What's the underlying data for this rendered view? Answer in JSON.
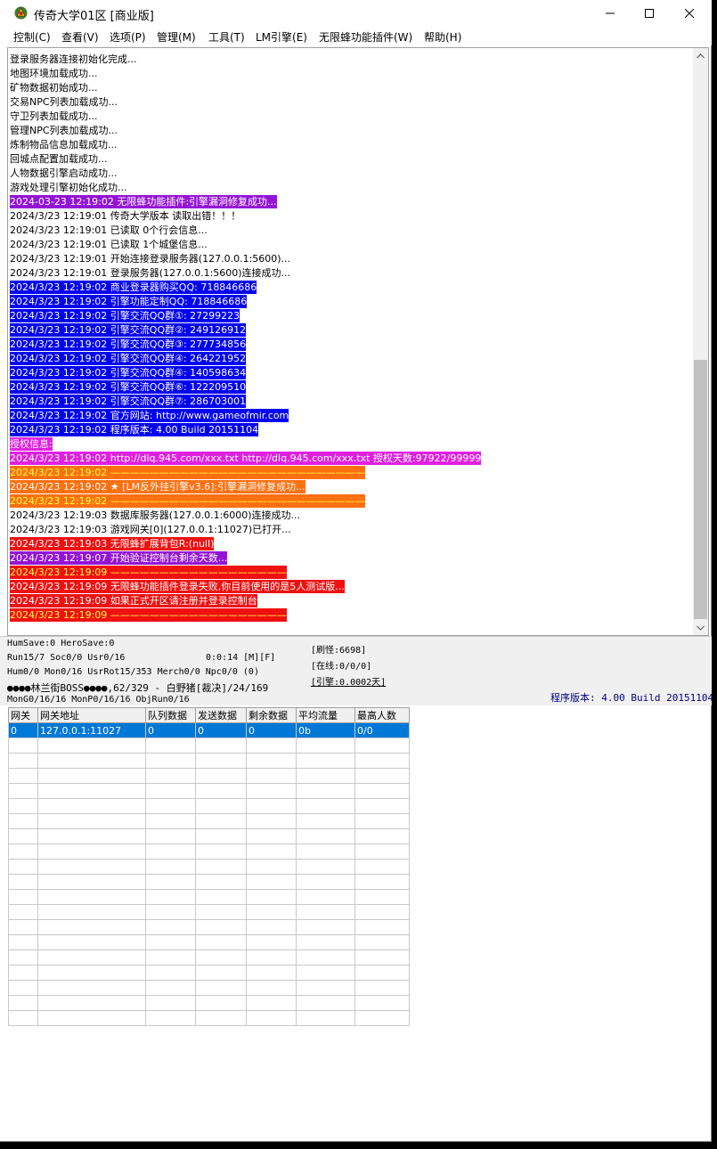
{
  "window": {
    "title": "传奇大学01区 [商业版]",
    "buttons": {
      "minimize": "—",
      "maximize": "☐",
      "close": "✕"
    }
  },
  "menu": [
    "控制(C)",
    "查看(V)",
    "选项(P)",
    "管理(M)",
    "工具(T)",
    "LM引擎(E)",
    "无限蜂功能插件(W)",
    "帮助(H)"
  ],
  "colors": {
    "purple": "#9414d6",
    "blue": "#0000f0",
    "magenta": "#e020e0",
    "orange": "#ff7010",
    "red": "#f01010"
  },
  "log": [
    {
      "text": "登录服务器连接初始化完成..."
    },
    {
      "text": "地图环境加载成功..."
    },
    {
      "text": "矿物数据初始成功..."
    },
    {
      "text": "交易NPC列表加载成功..."
    },
    {
      "text": "守卫列表加载成功..."
    },
    {
      "text": "管理NPC列表加载成功..."
    },
    {
      "text": "炼制物品信息加载成功..."
    },
    {
      "text": "回城点配置加载成功..."
    },
    {
      "text": "人物数据引擎启动成功..."
    },
    {
      "text": "游戏处理引擎初始化成功..."
    },
    {
      "text": "2024-03-23 12:19:02 无限蜂功能插件:引擎漏洞修复成功...",
      "bg": "purple"
    },
    {
      "text": "2024/3/23 12:19:01 传奇大学版本 读取出错！！！"
    },
    {
      "text": "2024/3/23 12:19:01 已读取 0个行会信息..."
    },
    {
      "text": "2024/3/23 12:19:01 已读取 1个城堡信息..."
    },
    {
      "text": "2024/3/23 12:19:01 开始连接登录服务器(127.0.0.1:5600)..."
    },
    {
      "text": "2024/3/23 12:19:01 登录服务器(127.0.0.1:5600)连接成功..."
    },
    {
      "text": "2024/3/23 12:19:02 商业登录器购买QQ: 718846686",
      "bg": "blue"
    },
    {
      "text": "2024/3/23 12:19:02 引擎功能定制QQ: 718846686",
      "bg": "blue"
    },
    {
      "text": "2024/3/23 12:19:02 引擎交流QQ群①: 27299223",
      "bg": "blue"
    },
    {
      "text": "2024/3/23 12:19:02 引擎交流QQ群②: 249126912",
      "bg": "blue"
    },
    {
      "text": "2024/3/23 12:19:02 引擎交流QQ群③: 277734856",
      "bg": "blue"
    },
    {
      "text": "2024/3/23 12:19:02 引擎交流QQ群④: 264221952",
      "bg": "blue"
    },
    {
      "text": "2024/3/23 12:19:02 引擎交流QQ群④: 140598634",
      "bg": "blue"
    },
    {
      "text": "2024/3/23 12:19:02 引擎交流QQ群⑥: 122209510",
      "bg": "blue"
    },
    {
      "text": "2024/3/23 12:19:02 引擎交流QQ群⑦: 286703001",
      "bg": "blue"
    },
    {
      "text": "2024/3/23 12:19:02 官方网站: http://www.gameofmir.com",
      "bg": "blue"
    },
    {
      "text": "2024/3/23 12:19:02 程序版本: 4.00 Build 20151104",
      "bg": "blue"
    },
    {
      "text": "授权信息:",
      "bg": "magenta"
    },
    {
      "text": "2024/3/23 12:19:02 http://dlq.945.com/xxx.txt http://dlq.945.com/xxx.txt 授权天数:97922/99999",
      "bg": "magenta"
    },
    {
      "text": "2024/3/23 12:19:02 ——————————————————————————",
      "bg": "orange",
      "yellow": true
    },
    {
      "text": "2024/3/23 12:19:02 ★ [LM反外挂引擎v3.6]:引擎漏洞修复成功...",
      "bg": "orange"
    },
    {
      "text": "2024/3/23 12:19:02 ——————————————————————————",
      "bg": "orange",
      "yellow": true
    },
    {
      "text": "2024/3/23 12:19:03 数据库服务器(127.0.0.1:6000)连接成功..."
    },
    {
      "text": "2024/3/23 12:19:03 游戏网关[0](127.0.0.1:11027)已打开..."
    },
    {
      "text": "2024/3/23 12:19:03 无限蜂扩展背包R:(null)",
      "bg": "red"
    },
    {
      "text": "2024/3/23 12:19:07 开始验证控制台剩余天数...",
      "bg": "purple"
    },
    {
      "text": "2024/3/23 12:19:09 ——————————————————",
      "bg": "red",
      "yellow": true
    },
    {
      "text": "2024/3/23 12:19:09 无限蜂功能插件登录失败,你目前使用的是5人测试版...",
      "bg": "red"
    },
    {
      "text": "2024/3/23 12:19:09 如果正式开区请注册并登录控制台",
      "bg": "red"
    },
    {
      "text": "2024/3/23 12:19:09 ——————————————————",
      "bg": "red",
      "yellow": true
    }
  ],
  "status": {
    "line1": "HumSave:0 HeroSave:0",
    "line2": "Run15/7 Soc0/0 Usr0/16",
    "time": "0:0:14 [M][F]",
    "line3": "Hum0/0 Mon0/16 UsrRot15/353 Merch0/0 Npc0/0 (0)",
    "line4": "●●●●林兰街BOSS●●●●,62/329 - 白野猪[裁决]/24/169",
    "line5": "MonG0/16/16 MonP0/16/16 ObjRun0/16",
    "refresh": "[刷怪:6698]",
    "online": "[在线:0/0/0]",
    "engine": "[引擎:0.0002天]",
    "version": "程序版本: 4.00 Build 20151104"
  },
  "gate_table": {
    "headers": [
      "网关",
      "网关地址",
      "队列数据",
      "发送数据",
      "剩余数据",
      "平均流量",
      "最高人数"
    ],
    "rows": [
      [
        "0",
        "127.0.0.1:11027",
        "0",
        "0",
        "0",
        "0b",
        "0/0"
      ]
    ],
    "empty_rows": 19
  }
}
